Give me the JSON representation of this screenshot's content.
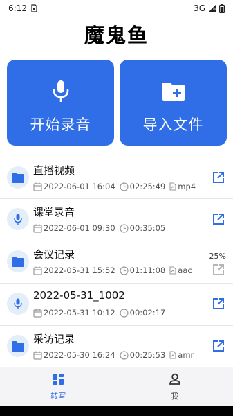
{
  "status_bar": {
    "time": "6:12",
    "network": "3G"
  },
  "app": {
    "title": "魔鬼鱼"
  },
  "actions": {
    "record": {
      "label": "开始录音",
      "icon": "microphone-icon"
    },
    "import": {
      "label": "导入文件",
      "icon": "folder-add-icon"
    }
  },
  "recordings": [
    {
      "title": "直播视频",
      "type_icon": "folder-icon",
      "date": "2022-06-01 16:04",
      "duration": "02:25:49",
      "format": "mp4",
      "progress": "",
      "action_icon": "share-icon"
    },
    {
      "title": "课堂录音",
      "type_icon": "microphone-icon",
      "date": "2022-06-01 09:30",
      "duration": "00:35:05",
      "format": "",
      "progress": "",
      "action_icon": "share-icon"
    },
    {
      "title": "会议记录",
      "type_icon": "folder-icon",
      "date": "2022-05-31 15:52",
      "duration": "01:11:08",
      "format": "aac",
      "progress": "25%",
      "action_icon": "share-icon"
    },
    {
      "title": "2022-05-31_1002",
      "type_icon": "microphone-icon",
      "date": "2022-05-31 10:12",
      "duration": "00:02:17",
      "format": "",
      "progress": "",
      "action_icon": "share-icon"
    },
    {
      "title": " 采访记录",
      "type_icon": "folder-icon",
      "date": "2022-05-30 16:24",
      "duration": "00:25:53",
      "format": "amr",
      "progress": "",
      "action_icon": "share-icon"
    }
  ],
  "bottom_nav": [
    {
      "label": "转写",
      "icon": "grid-icon",
      "active": true
    },
    {
      "label": "我",
      "icon": "person-icon",
      "active": false
    }
  ],
  "colors": {
    "accent": "#2f6ee6",
    "icon_bg": "#e4eef8",
    "muted": "#9a9a9a"
  }
}
